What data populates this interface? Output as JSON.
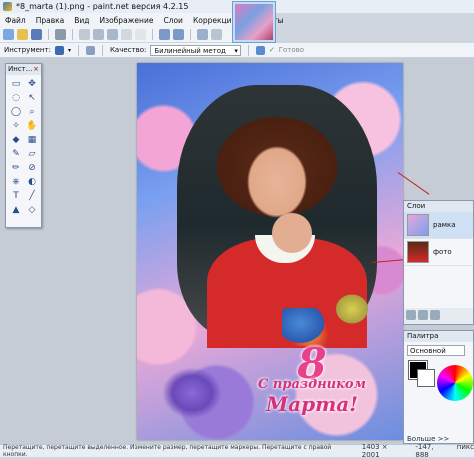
{
  "window": {
    "title": "*8_marta (1).png - paint.net версия 4.2.15"
  },
  "menu": [
    "Файл",
    "Правка",
    "Вид",
    "Изображение",
    "Слои",
    "Коррекция",
    "Эффекты"
  ],
  "options": {
    "tool_label": "Инструмент:",
    "quality_label": "Качество:",
    "quality_value": "Билинейный метод",
    "done_label": "Готово"
  },
  "tools_panel": {
    "title": "Инст..."
  },
  "canvas": {
    "greeting_digit": "8",
    "greeting_line1": "С праздником",
    "greeting_line2": "Марта!"
  },
  "layers_panel": {
    "title": "Слои",
    "layers": [
      {
        "name": "рамка",
        "selected": true
      },
      {
        "name": "фото",
        "selected": false
      }
    ]
  },
  "palette_panel": {
    "title": "Палитра",
    "mode": "Основной",
    "more": "Больше >>"
  },
  "status": {
    "hint": "Перетащите, перетащите выделенное. Измените размер, перетащите маркеры. Перетащите с правой кнопки.",
    "image_size": "1403 × 2001",
    "cursor": "-147, 888",
    "units": "пикс"
  },
  "colors": {
    "accent": "#4a7fd0",
    "primary": "#000000",
    "secondary": "#ffffff"
  }
}
